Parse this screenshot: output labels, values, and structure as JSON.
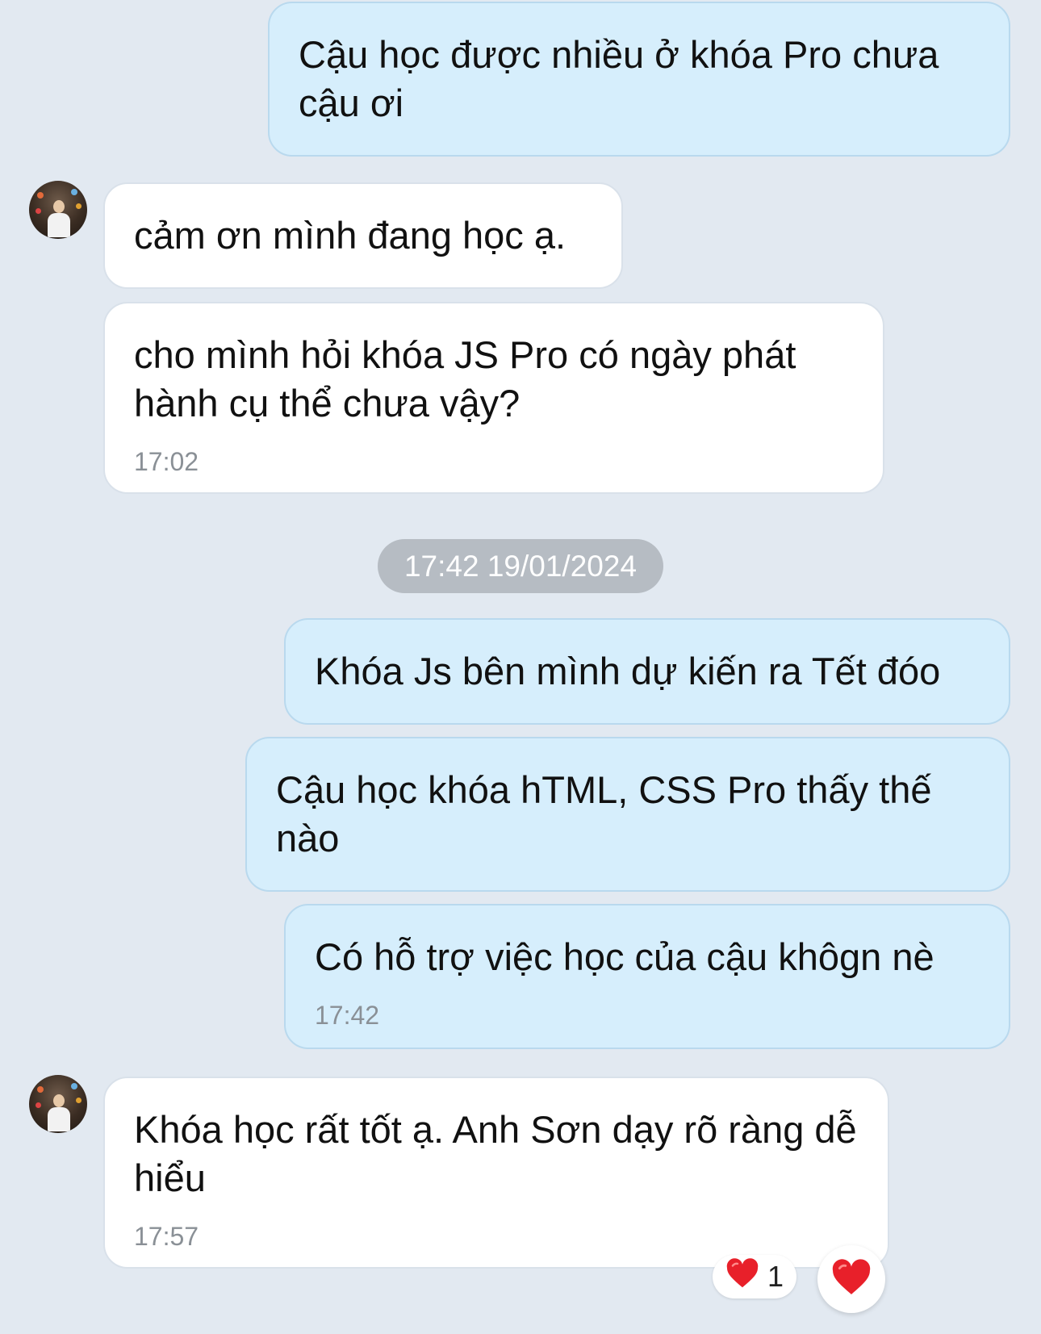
{
  "colors": {
    "background": "#e2e9f1",
    "outgoing_bubble": "#d6eefc",
    "incoming_bubble": "#ffffff",
    "timestamp_text": "#8a9096",
    "date_pill": "#b6bcc3",
    "heart": "#e8202a"
  },
  "messages": [
    {
      "direction": "outgoing",
      "text": "Cậu học được nhiều ở khóa Pro chưa cậu ơi",
      "time": ""
    },
    {
      "direction": "incoming",
      "text": "cảm ơn mình đang học ạ.",
      "time": ""
    },
    {
      "direction": "incoming",
      "text": "cho mình hỏi khóa JS Pro có ngày phát hành cụ thể chưa vậy?",
      "time": "17:02"
    },
    {
      "direction": "outgoing",
      "text": "Khóa Js bên mình dự kiến ra Tết đóo",
      "time": ""
    },
    {
      "direction": "outgoing",
      "text": "Cậu học khóa hTML, CSS Pro thấy thế nào",
      "time": ""
    },
    {
      "direction": "outgoing",
      "text": "Có hỗ trợ việc học của cậu khôgn nè",
      "time": "17:42"
    },
    {
      "direction": "incoming",
      "text": "Khóa học rất tốt ạ. Anh Sơn dạy rõ ràng dễ hiểu",
      "time": "17:57"
    }
  ],
  "date_separator": "17:42 19/01/2024",
  "reactions": {
    "icon": "heart-icon",
    "count": "1"
  },
  "reaction_button": {
    "icon": "heart-icon"
  }
}
